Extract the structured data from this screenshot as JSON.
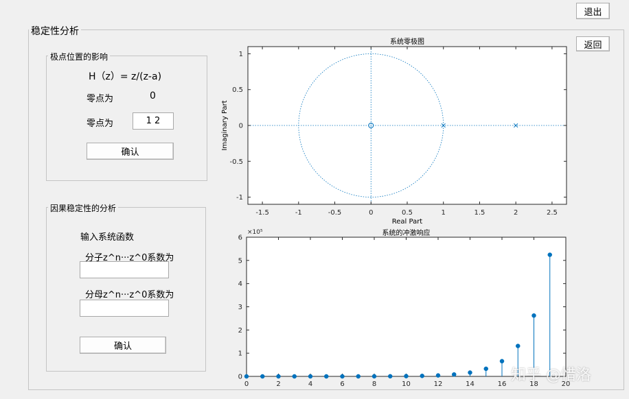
{
  "window": {
    "exit_label": "退出",
    "back_label": "返回"
  },
  "main_panel": {
    "title": "稳定性分析"
  },
  "pole_panel": {
    "title": "极点位置的影响",
    "transfer_function": "H（z）= z/(z-a)",
    "zero_label": "零点为",
    "zero_value": "0",
    "pole_label": "零点为",
    "pole_input_value": "1 2",
    "confirm_label": "确认"
  },
  "causal_panel": {
    "title": "因果稳定性的分析",
    "input_prompt": "输入系统函数",
    "numerator_label": "分子z^n···z^0系数为",
    "numerator_value": "",
    "denominator_label": "分母z^n···z^0系数为",
    "denominator_value": "",
    "confirm_label": "确认"
  },
  "watermark": "知乎 @惜洛",
  "colors": {
    "matlab_blue": "#0072bd",
    "background": "#f0f0f0"
  },
  "chart_data": [
    {
      "type": "scatter",
      "title": "系统零极图",
      "xlabel": "Real Part",
      "ylabel": "Imaginary Part",
      "xlim": [
        -1.7,
        2.7
      ],
      "ylim": [
        -1.1,
        1.1
      ],
      "xticks": [
        -1.5,
        -1,
        -0.5,
        0,
        0.5,
        1,
        1.5,
        2,
        2.5
      ],
      "xtick_labels": [
        "-1.5",
        "-1",
        "-0.5",
        "0",
        "0.5",
        "1",
        "1.5",
        "2",
        "2.5"
      ],
      "yticks": [
        -1,
        -0.5,
        0,
        0.5,
        1
      ],
      "ytick_labels": [
        "-1",
        "-0.5",
        "0",
        "0.5",
        "1"
      ],
      "unit_circle": true,
      "zeros": [
        [
          0,
          0
        ]
      ],
      "poles": [
        [
          1,
          0
        ],
        [
          2,
          0
        ]
      ]
    },
    {
      "type": "stem",
      "title": "系统的冲激响应",
      "xlabel": "",
      "ylabel": "",
      "exponent_label": "×10⁵",
      "xlim": [
        0,
        20
      ],
      "ylim": [
        0,
        600000
      ],
      "xticks": [
        0,
        2,
        4,
        6,
        8,
        10,
        12,
        14,
        16,
        18,
        20
      ],
      "xtick_labels": [
        "0",
        "2",
        "4",
        "6",
        "8",
        "10",
        "12",
        "14",
        "16",
        "18",
        "20"
      ],
      "yticks": [
        0,
        100000,
        200000,
        300000,
        400000,
        500000,
        600000
      ],
      "ytick_labels": [
        "0",
        "1",
        "2",
        "3",
        "4",
        "5",
        "6"
      ],
      "x": [
        0,
        1,
        2,
        3,
        4,
        5,
        6,
        7,
        8,
        9,
        10,
        11,
        12,
        13,
        14,
        15,
        16,
        17,
        18,
        19
      ],
      "values": [
        0,
        1,
        3,
        7,
        15,
        31,
        63,
        127,
        255,
        511,
        1023,
        2047,
        4095,
        8191,
        16383,
        32767,
        65535,
        131071,
        262143,
        524287
      ]
    }
  ]
}
